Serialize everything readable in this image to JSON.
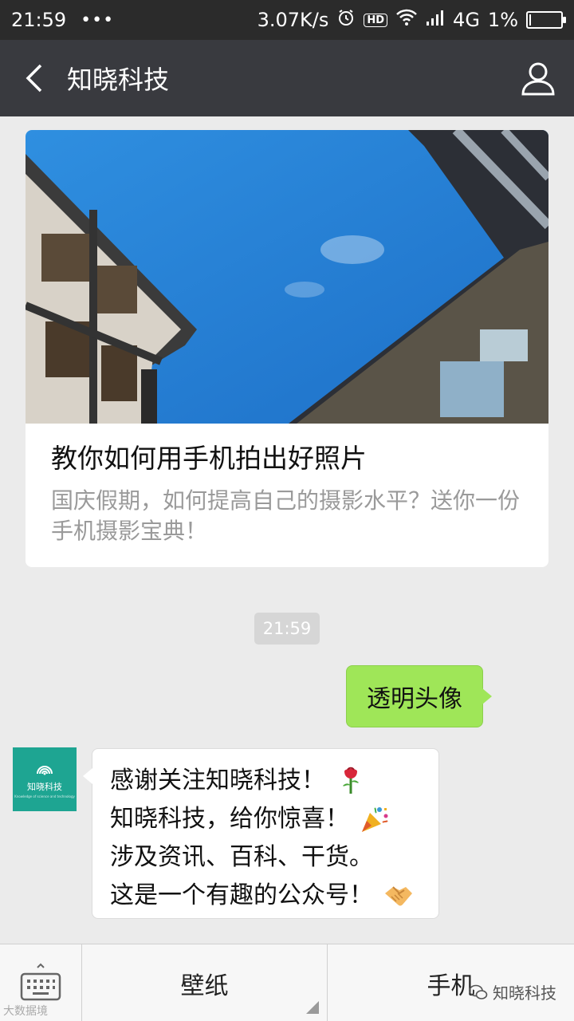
{
  "status_bar": {
    "time": "21:59",
    "dots": "•••",
    "network_speed": "3.07K/s",
    "hd": "HD",
    "network_type": "4G",
    "battery": "1%",
    "battery_level": 0.01
  },
  "header": {
    "title": "知晓科技"
  },
  "article": {
    "title": "教你如何用手机拍出好照片",
    "description": "国庆假期，如何提高自己的摄影水平？送你一份手机摄影宝典！"
  },
  "chat": {
    "timestamp": "21:59",
    "sent_message": "透明头像",
    "avatar_text": "知晓科技",
    "avatar_subtext": "Knowledge of science and technology",
    "received_lines": [
      {
        "text": "感谢关注知晓科技！",
        "emoji": "rose-emoji"
      },
      {
        "text": "知晓科技，给你惊喜！",
        "emoji": "party-popper-emoji"
      },
      {
        "text": "涉及资讯、百科、干货。",
        "emoji": ""
      },
      {
        "text": "这是一个有趣的公众号！",
        "emoji": "handshake-emoji"
      }
    ]
  },
  "menu": {
    "item1": "壁纸",
    "item2": "手机",
    "watermark": "知晓科技",
    "watermark_left": "大数据境"
  },
  "colors": {
    "status_bar": "#2b2b2b",
    "title_bar": "#393a3f",
    "background": "#ebebeb",
    "sent_bubble": "#9fe658",
    "avatar": "#1ea592"
  }
}
